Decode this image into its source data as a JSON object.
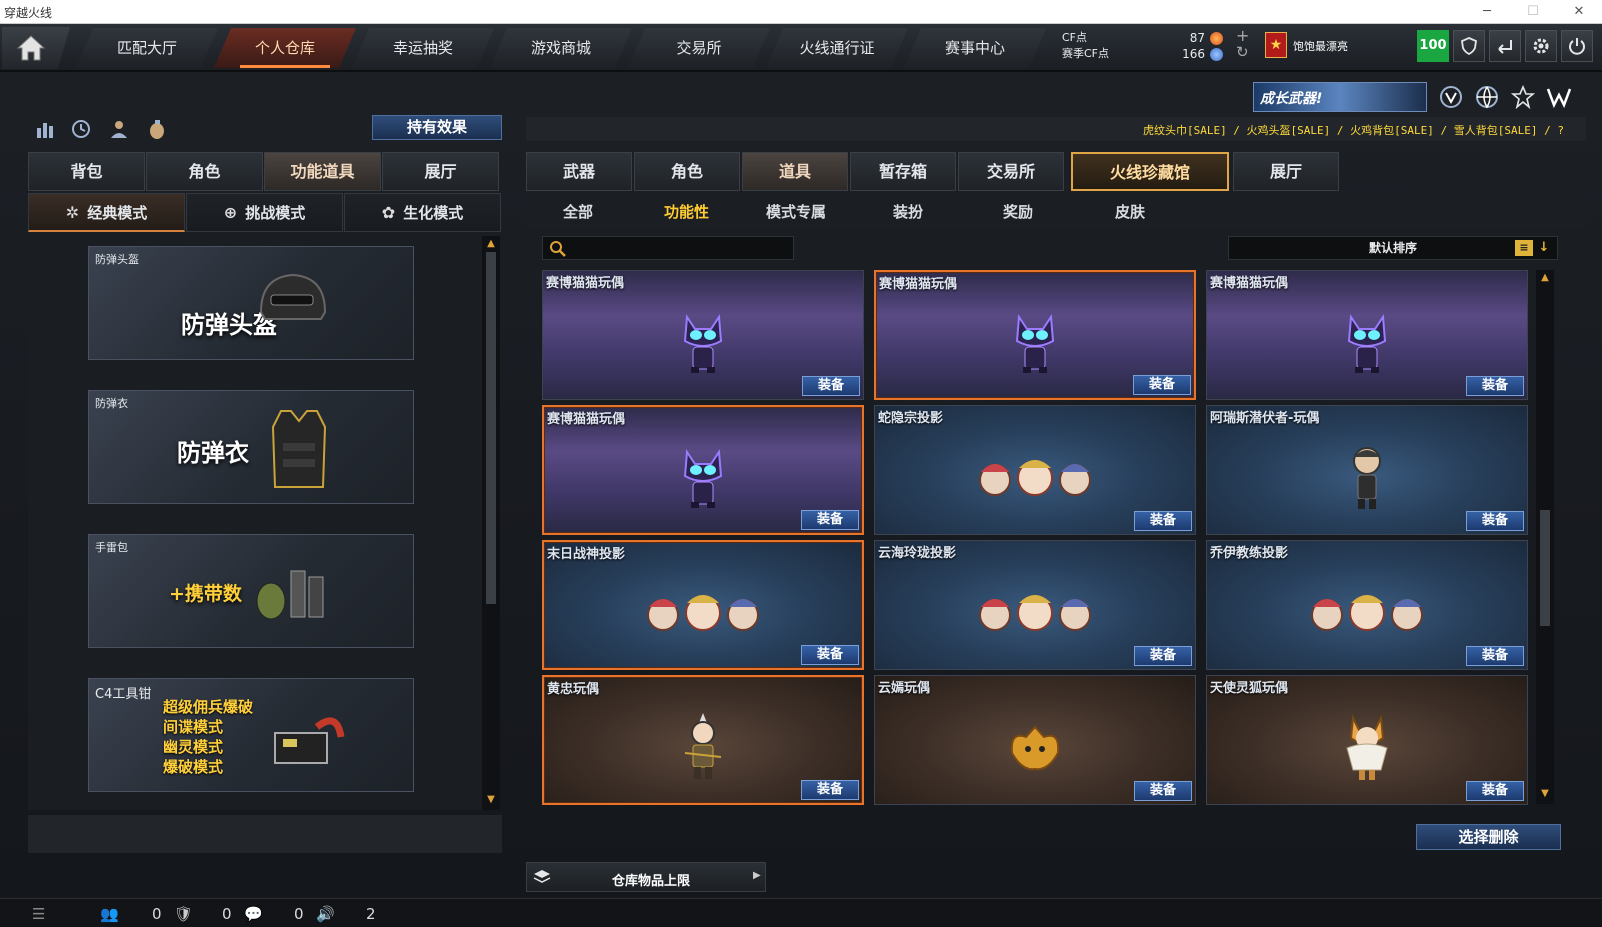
{
  "window": {
    "title": "穿越火线"
  },
  "nav": {
    "tabs": [
      "匹配大厅",
      "个人仓库",
      "幸运抽奖",
      "游戏商城",
      "交易所",
      "火线通行证",
      "赛事中心"
    ],
    "active_index": 1
  },
  "currency": {
    "cf_label": "CF点",
    "season_label": "赛季CF点",
    "cf_value": "87",
    "season_value": "166"
  },
  "player": {
    "name": "饱饱最漂亮",
    "level": "100"
  },
  "left": {
    "effect_button": "持有效果",
    "tabs": [
      "背包",
      "角色",
      "功能道具",
      "展厅"
    ],
    "active_tab": 2,
    "modes": [
      "经典模式",
      "挑战模式",
      "生化模式"
    ],
    "active_mode": 0,
    "items": [
      {
        "name": "防弹头盔",
        "big": "防弹头盔"
      },
      {
        "name": "防弹衣",
        "big": "防弹衣"
      },
      {
        "name": "手雷包",
        "big": "+携带数"
      },
      {
        "name": "C4工具钳",
        "lines": [
          "超级佣兵爆破",
          "间谍模式",
          "幽灵模式",
          "爆破模式"
        ]
      }
    ]
  },
  "right": {
    "banner": "成长武器!",
    "sale_text": "虎纹头巾[SALE] / 火鸡头盔[SALE] / 火鸡背包[SALE] / 雪人背包[SALE] / ?",
    "tabs": [
      "武器",
      "角色",
      "道具",
      "暂存箱",
      "交易所",
      "火线珍藏馆",
      "展厅"
    ],
    "active_tab": 2,
    "highlight_tab": 5,
    "subtabs": [
      "全部",
      "功能性",
      "模式专属",
      "装扮",
      "奖励",
      "皮肤"
    ],
    "active_subtab": 1,
    "search_placeholder": "",
    "sort_label": "默认排序",
    "equip_label": "装备",
    "cards": [
      {
        "name": "赛博猫猫玩偶",
        "theme": "purple",
        "selected": false,
        "figure": "cat-doll-icon"
      },
      {
        "name": "赛博猫猫玩偶",
        "theme": "purple",
        "selected": true,
        "figure": "cat-doll-icon"
      },
      {
        "name": "赛博猫猫玩偶",
        "theme": "purple",
        "selected": false,
        "figure": "cat-doll-icon"
      },
      {
        "name": "赛博猫猫玩偶",
        "theme": "purple",
        "selected": true,
        "figure": "cat-doll-icon"
      },
      {
        "name": "蛇隐宗投影",
        "theme": "blue",
        "selected": false,
        "figure": "trio-icon"
      },
      {
        "name": "阿瑞斯潜伏者-玩偶",
        "theme": "blue",
        "selected": false,
        "figure": "soldier-doll-icon"
      },
      {
        "name": "末日战神投影",
        "theme": "blue",
        "selected": true,
        "figure": "trio-icon"
      },
      {
        "name": "云海玲珑投影",
        "theme": "blue",
        "selected": false,
        "figure": "trio-icon"
      },
      {
        "name": "乔伊教练投影",
        "theme": "blue",
        "selected": false,
        "figure": "trio-icon"
      },
      {
        "name": "黄忠玩偶",
        "theme": "brown",
        "selected": true,
        "figure": "warrior-doll-icon"
      },
      {
        "name": "云嫣玩偶",
        "theme": "brown",
        "selected": false,
        "figure": "dragon-doll-icon"
      },
      {
        "name": "天使灵狐玩偶",
        "theme": "brown",
        "selected": false,
        "figure": "fox-doll-icon"
      }
    ],
    "delete_button": "选择删除",
    "limit_label": "仓库物品上限"
  },
  "status": {
    "count1": "0",
    "count2": "0",
    "count3": "0",
    "count4": "2"
  }
}
